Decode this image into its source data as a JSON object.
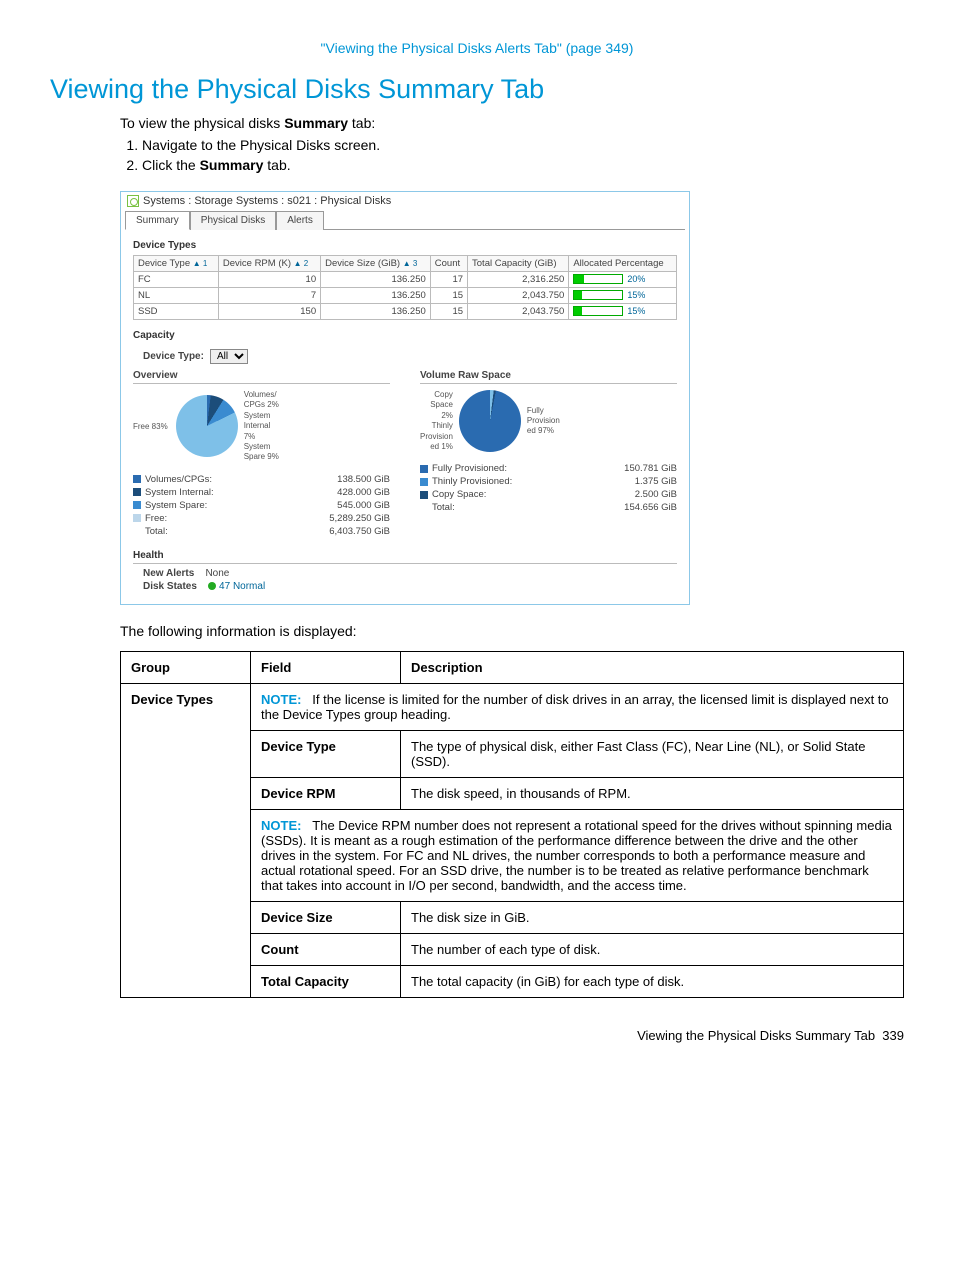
{
  "top_link": "\"Viewing the Physical Disks Alerts Tab\" (page 349)",
  "heading": "Viewing the Physical Disks Summary Tab",
  "intro_prefix": "To view the physical disks ",
  "intro_bold": "Summary",
  "intro_suffix": " tab:",
  "steps": {
    "s1": "Navigate to the Physical Disks screen.",
    "s2_pre": "Click the ",
    "s2_bold": "Summary",
    "s2_post": " tab."
  },
  "screenshot": {
    "title": "Systems : Storage Systems : s021 : Physical Disks",
    "tabs": {
      "t1": "Summary",
      "t2": "Physical Disks",
      "t3": "Alerts"
    },
    "device_types_label": "Device Types",
    "headers": {
      "h1": "Device Type",
      "h1s": "▲ 1",
      "h2": "Device RPM (K)",
      "h2s": "▲ 2",
      "h3": "Device Size (GiB)",
      "h3s": "▲ 3",
      "h4": "Count",
      "h5": "Total Capacity (GiB)",
      "h6": "Allocated Percentage"
    },
    "rows": [
      {
        "type": "FC",
        "rpm": "10",
        "size": "136.250",
        "count": "17",
        "cap": "2,316.250",
        "pct": "20%",
        "w": "20%"
      },
      {
        "type": "NL",
        "rpm": "7",
        "size": "136.250",
        "count": "15",
        "cap": "2,043.750",
        "pct": "15%",
        "w": "15%"
      },
      {
        "type": "SSD",
        "rpm": "150",
        "size": "136.250",
        "count": "15",
        "cap": "2,043.750",
        "pct": "15%",
        "w": "15%"
      }
    ],
    "capacity_label": "Capacity",
    "device_type_filter_label": "Device Type:",
    "device_type_filter_value": "All",
    "overview_label": "Overview",
    "volume_raw_label": "Volume Raw Space",
    "pie1_labels": {
      "free": "Free 83%",
      "a": "Volumes/\nCPGs 2%",
      "b": "System\nInternal\n7%",
      "c": "System\nSpare 9%"
    },
    "pie2_labels": {
      "a": "Copy\nSpace\n2%",
      "b": "Thinly\nProvision\ned 1%",
      "c": "Fully\nProvision\ned 97%"
    },
    "overview_legend": [
      {
        "c": "c1",
        "name": "Volumes/CPGs:",
        "val": "138.500 GiB"
      },
      {
        "c": "c2",
        "name": "System Internal:",
        "val": "428.000 GiB"
      },
      {
        "c": "c3",
        "name": "System Spare:",
        "val": "545.000 GiB"
      },
      {
        "c": "c4",
        "name": "Free:",
        "val": "5,289.250 GiB"
      },
      {
        "c": "",
        "name": "Total:",
        "val": "6,403.750 GiB"
      }
    ],
    "vrs_legend": [
      {
        "c": "c1",
        "name": "Fully Provisioned:",
        "val": "150.781 GiB"
      },
      {
        "c": "c3",
        "name": "Thinly Provisioned:",
        "val": "1.375 GiB"
      },
      {
        "c": "c2",
        "name": "Copy Space:",
        "val": "2.500 GiB"
      },
      {
        "c": "",
        "name": "Total:",
        "val": "154.656 GiB"
      }
    ],
    "health_label": "Health",
    "new_alerts_label": "New Alerts",
    "new_alerts_value": "None",
    "disk_states_label": "Disk States",
    "disk_states_value": "47 Normal"
  },
  "below_shot": "The following information is displayed:",
  "table_headers": {
    "group": "Group",
    "field": "Field",
    "desc": "Description"
  },
  "table": {
    "group1": "Device Types",
    "note_label": "NOTE:",
    "note1": "If the license is limited for the number of disk drives in an array, the licensed limit is displayed next to the Device Types group heading.",
    "f1": "Device Type",
    "d1": "The type of physical disk, either Fast Class (FC), Near Line (NL), or Solid State (SSD).",
    "f2": "Device RPM",
    "d2": "The disk speed, in thousands of RPM.",
    "note2": "The Device RPM number does not represent a rotational speed for the drives without spinning media (SSDs). It is meant as a rough estimation of the performance difference between the drive and the other drives in the system. For FC and NL drives, the number corresponds to both a performance measure and actual rotational speed. For an SSD drive, the number is to be treated as relative performance benchmark that takes into account in I/O per second, bandwidth, and the access time.",
    "f3": "Device Size",
    "d3": "The disk size in GiB.",
    "f4": "Count",
    "d4": "The number of each type of disk.",
    "f5": "Total Capacity",
    "d5": "The total capacity (in GiB) for each type of disk."
  },
  "footer": {
    "text": "Viewing the Physical Disks Summary Tab",
    "page": "339"
  },
  "chart_data": [
    {
      "type": "pie",
      "title": "Overview",
      "series": [
        {
          "name": "Volumes/CPGs",
          "value": 2,
          "gib": 138.5
        },
        {
          "name": "System Internal",
          "value": 7,
          "gib": 428.0
        },
        {
          "name": "System Spare",
          "value": 9,
          "gib": 545.0
        },
        {
          "name": "Free",
          "value": 83,
          "gib": 5289.25
        }
      ],
      "total_gib": 6403.75
    },
    {
      "type": "pie",
      "title": "Volume Raw Space",
      "series": [
        {
          "name": "Copy Space",
          "value": 2,
          "gib": 2.5
        },
        {
          "name": "Thinly Provisioned",
          "value": 1,
          "gib": 1.375
        },
        {
          "name": "Fully Provisioned",
          "value": 97,
          "gib": 150.781
        }
      ],
      "total_gib": 154.656
    }
  ]
}
